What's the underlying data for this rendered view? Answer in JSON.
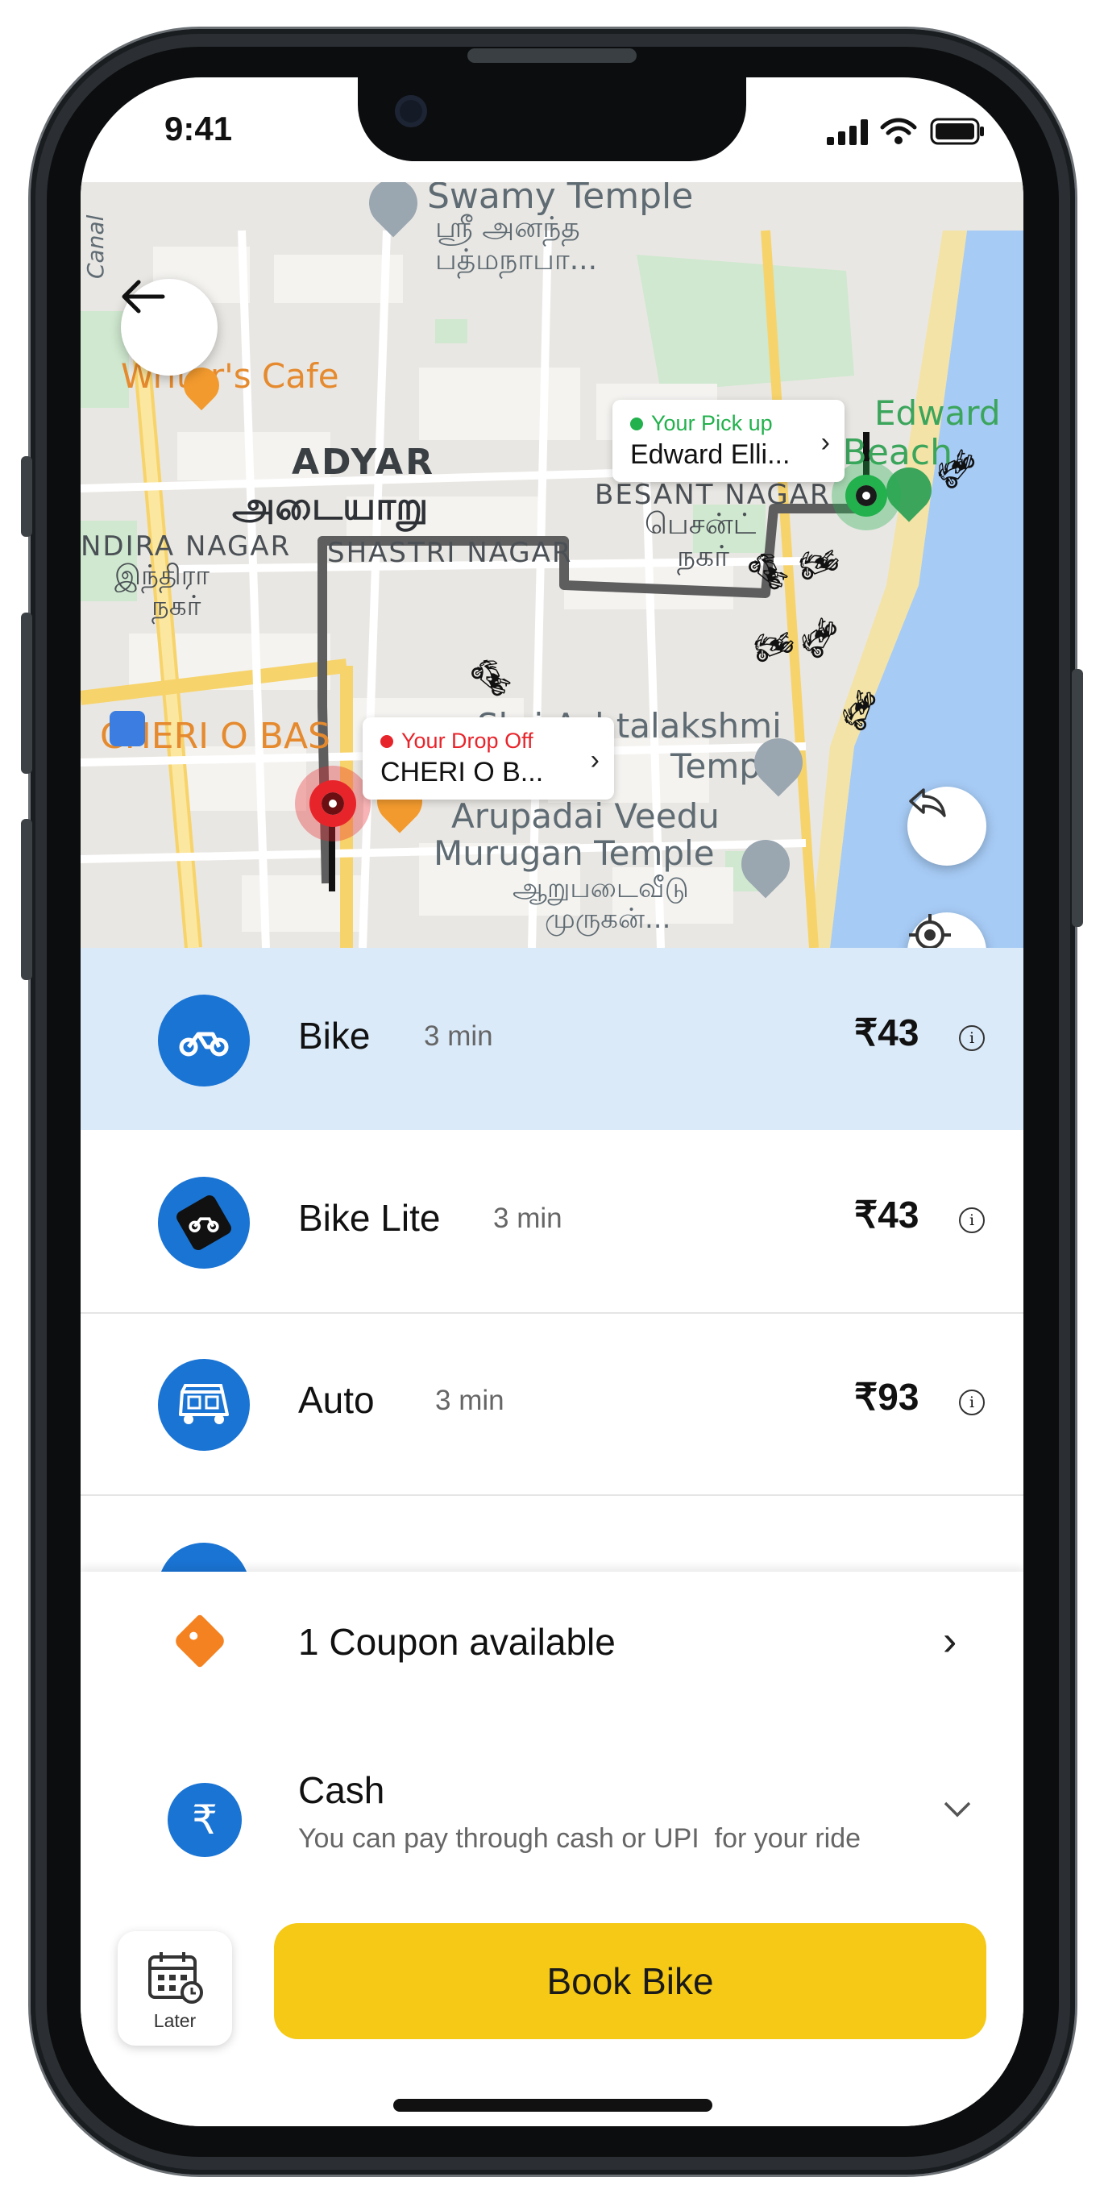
{
  "status_bar": {
    "time": "9:41"
  },
  "map": {
    "labels": {
      "swamy_temple": "Swamy Temple",
      "swamy_temple_ta1": "ஸ்ரீ அனந்த",
      "swamy_temple_ta2": "பத்மநாபா...",
      "canal": "Canal",
      "writers_cafe": "Writer's Cafe",
      "adyar": "ADYAR",
      "adyar_ta": "அடையாறு",
      "indira_nagar": "NDIRA NAGAR",
      "indira_nagar_ta1": "இந்திரா",
      "indira_nagar_ta2": "நகர்",
      "shastri_nagar": "SHASTRI NAGAR",
      "besant_nagar": "BESANT NAGAR",
      "besant_nagar_ta1": "பெசன்ட்",
      "besant_nagar_ta2": "நகர்",
      "elliots_beach_1": "Edward",
      "elliots_beach_2": "Elliot's Beach",
      "cheri": "CHERI O BAS",
      "ashtalakshmi_1": "Shri Ashtalakshmi",
      "ashtalakshmi_2": "Temple",
      "arupadai_1": "Arupadai Veedu",
      "arupadai_2": "Murugan Temple",
      "arupadai_ta1": "ஆறுபடைவீடு",
      "arupadai_ta2": "முருகன்..."
    },
    "pickup": {
      "label": "Your Pick up",
      "place": "Edward Elli...",
      "color": "#22b14c"
    },
    "dropoff": {
      "label": "Your Drop Off",
      "place": "CHERI O B...",
      "color": "#e8242b"
    }
  },
  "rides": [
    {
      "name": "Bike",
      "eta": "3 min",
      "price": "₹43",
      "icon": "bike-icon",
      "selected": true
    },
    {
      "name": "Bike Lite",
      "eta": "3 min",
      "price": "₹43",
      "icon": "bike-lite-icon",
      "selected": false
    },
    {
      "name": "Auto",
      "eta": "3 min",
      "price": "₹93",
      "icon": "auto-rickshaw-icon",
      "selected": false
    }
  ],
  "coupon": {
    "label": "1 Coupon available"
  },
  "payment": {
    "title": "Cash",
    "subtitle": "You can pay through cash or UPI  for your ride",
    "symbol": "₹"
  },
  "actions": {
    "later_label": "Later",
    "book_label": "Book Bike"
  },
  "colors": {
    "accent_blue": "#1a74d4",
    "selected_row": "#dbeaf9",
    "book_yellow": "#f5c915",
    "coupon_orange": "#f58220"
  }
}
